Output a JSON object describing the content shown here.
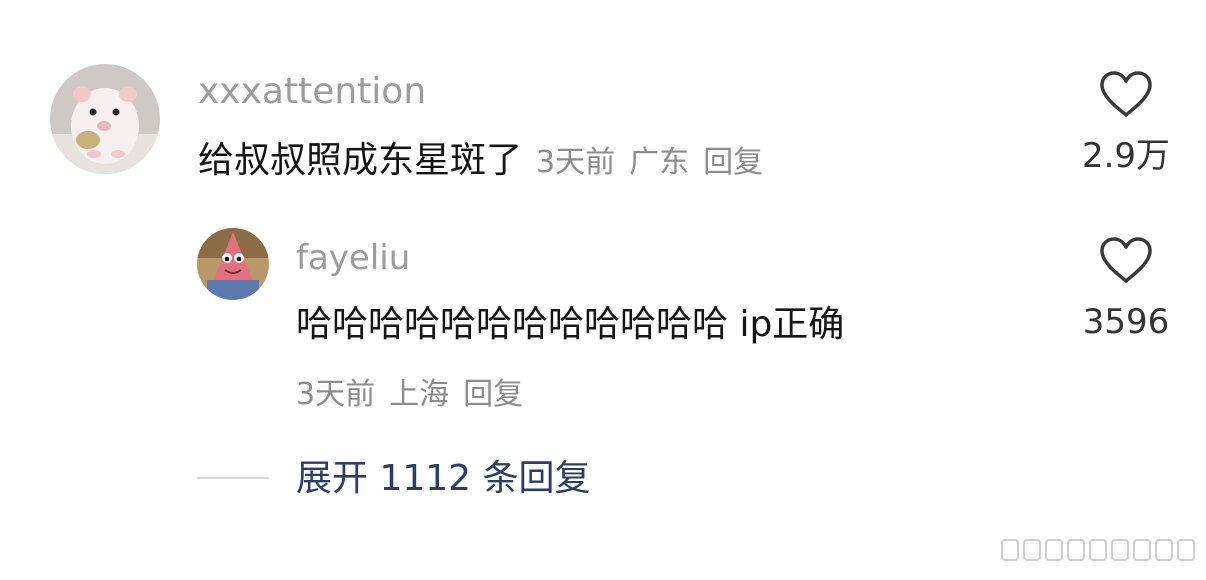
{
  "comment": {
    "username": "xxxattention",
    "text": "给叔叔照成东星斑了",
    "time": "3天前",
    "location": "广东",
    "reply_label": "回复",
    "likes": "2.9万",
    "avatar_icon": "hamster-avatar-icon"
  },
  "reply": {
    "username": "fayeliu",
    "text": "哈哈哈哈哈哈哈哈哈哈哈哈 ip正确",
    "time": "3天前",
    "location": "上海",
    "reply_label": "回复",
    "likes": "3596",
    "avatar_icon": "patrick-star-avatar-icon"
  },
  "expand_label": "展开 1112 条回复",
  "colors": {
    "username": "#9c9c9c",
    "meta": "#8d8d8d",
    "expand": "#2b3f66"
  }
}
